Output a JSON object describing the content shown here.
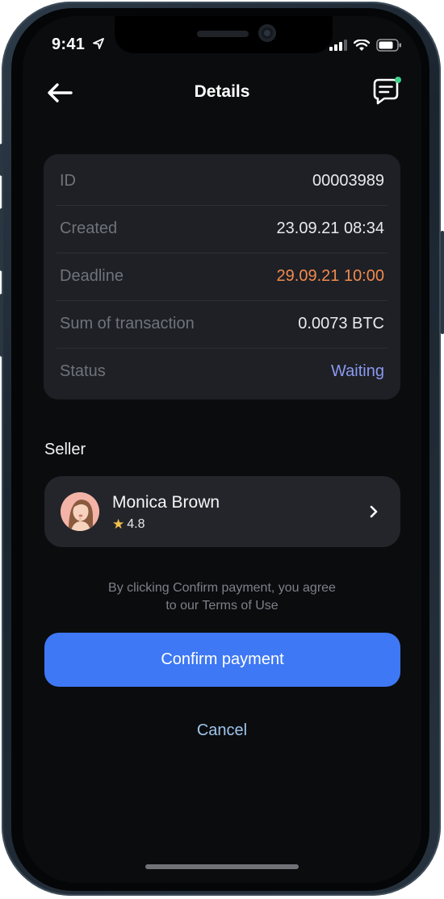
{
  "status_bar": {
    "time": "9:41"
  },
  "header": {
    "title": "Details"
  },
  "details": {
    "rows": [
      {
        "label": "ID",
        "value": "00003989"
      },
      {
        "label": "Created",
        "value": "23.09.21 08:34"
      },
      {
        "label": "Deadline",
        "value": "29.09.21 10:00"
      },
      {
        "label": "Sum of transaction",
        "value": "0.0073 BTC"
      },
      {
        "label": "Status",
        "value": "Waiting"
      }
    ]
  },
  "seller": {
    "section_title": "Seller",
    "name": "Monica Brown",
    "rating": "4.8"
  },
  "terms_text": {
    "line1": "By clicking Confirm payment, you agree",
    "line2": "to our Terms of Use"
  },
  "actions": {
    "confirm_label": "Confirm payment",
    "cancel_label": "Cancel"
  },
  "colors": {
    "accent": "#3e78f5",
    "deadline": "#f28a4e",
    "status_waiting": "#8b99f0",
    "cancel": "#9ec6ee",
    "chat_notification_dot": "#3ed38a"
  }
}
